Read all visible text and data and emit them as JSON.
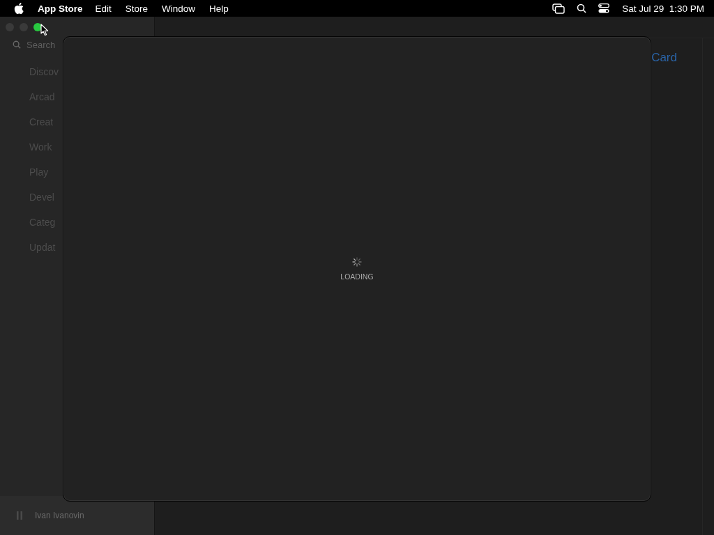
{
  "menu_bar": {
    "app_name": "App Store",
    "menus": [
      "Edit",
      "Store",
      "Window",
      "Help"
    ],
    "clock": "Sat Jul 29  1:30 PM"
  },
  "window": {
    "traffic_lights": [
      {
        "kind": "close",
        "on": false
      },
      {
        "kind": "minimize",
        "on": false
      },
      {
        "kind": "zoom",
        "on": true
      }
    ],
    "sidebar": {
      "search": {
        "placeholder": "Search"
      },
      "items": [
        {
          "label": "Discov"
        },
        {
          "label": "Arcad"
        },
        {
          "label": "Creat"
        },
        {
          "label": "Work"
        },
        {
          "label": "Play"
        },
        {
          "label": "Devel"
        },
        {
          "label": "Categ"
        },
        {
          "label": "Updat"
        }
      ],
      "account": {
        "name": "Ivan Ivanovin"
      }
    },
    "main": {
      "link": "Card"
    },
    "sheet": {
      "status": "LOADING"
    }
  }
}
